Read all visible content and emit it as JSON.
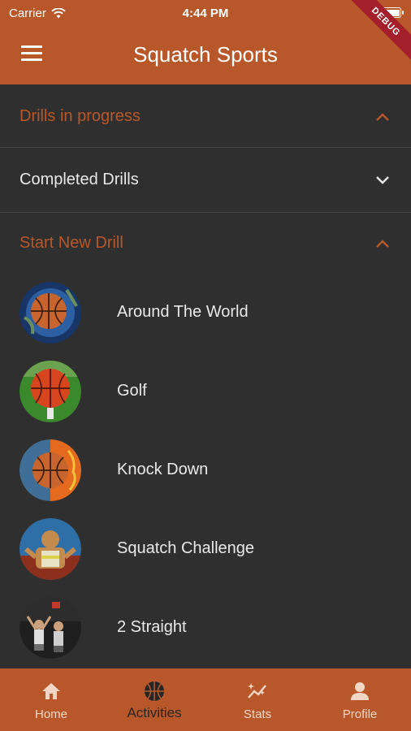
{
  "status_bar": {
    "carrier": "Carrier",
    "time": "4:44 PM"
  },
  "debug_banner": "DEBUG",
  "app_bar": {
    "title": "Squatch Sports"
  },
  "sections": {
    "in_progress": {
      "label": "Drills in progress",
      "expanded": true
    },
    "completed": {
      "label": "Completed Drills",
      "expanded": false
    },
    "start_new": {
      "label": "Start New Drill",
      "expanded": true
    }
  },
  "drills": [
    {
      "name": "Around The World",
      "icon": "globe-basketball-thumb"
    },
    {
      "name": "Golf",
      "icon": "golf-basketball-thumb"
    },
    {
      "name": "Knock Down",
      "icon": "fire-water-basketball-thumb"
    },
    {
      "name": "Squatch Challenge",
      "icon": "squatch-thumb"
    },
    {
      "name": "2 Straight",
      "icon": "players-thumb"
    }
  ],
  "bottom_nav": [
    {
      "label": "Home",
      "icon": "home-icon",
      "active": false
    },
    {
      "label": "Activities",
      "icon": "basketball-icon",
      "active": true
    },
    {
      "label": "Stats",
      "icon": "stats-icon",
      "active": false
    },
    {
      "label": "Profile",
      "icon": "person-icon",
      "active": false
    }
  ],
  "colors": {
    "accent": "#b8582a",
    "background": "#2f2f2f",
    "section_active_text": "#b8582a",
    "section_inactive_text": "#e9e9e9",
    "debug_ribbon": "#a31f2b"
  }
}
